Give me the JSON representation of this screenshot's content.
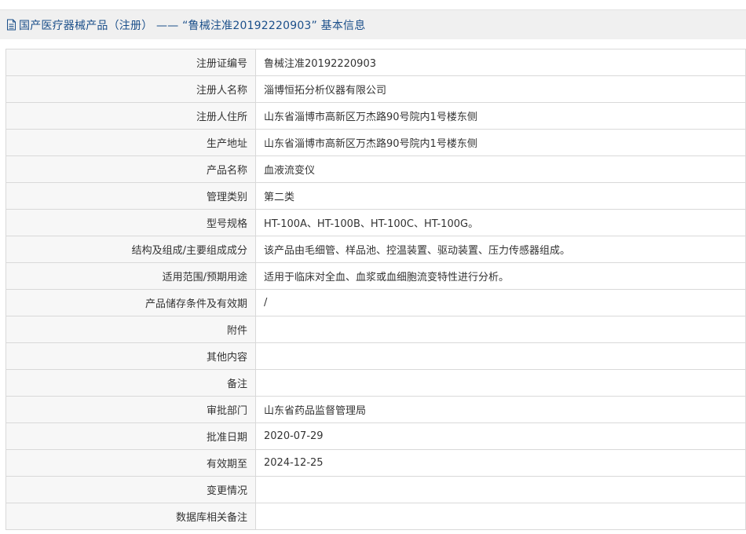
{
  "header": {
    "title": "国产医疗器械产品（注册） —— “鲁械注准20192220903” 基本信息",
    "icon": "document-icon"
  },
  "fields": [
    {
      "label": "注册证编号",
      "value": "鲁械注准20192220903"
    },
    {
      "label": "注册人名称",
      "value": "淄博恒拓分析仪器有限公司"
    },
    {
      "label": "注册人住所",
      "value": "山东省淄博市高新区万杰路90号院内1号楼东侧"
    },
    {
      "label": "生产地址",
      "value": "山东省淄博市高新区万杰路90号院内1号楼东侧"
    },
    {
      "label": "产品名称",
      "value": "血液流变仪"
    },
    {
      "label": "管理类别",
      "value": "第二类"
    },
    {
      "label": "型号规格",
      "value": "HT-100A、HT-100B、HT-100C、HT-100G。"
    },
    {
      "label": "结构及组成/主要组成成分",
      "value": "该产品由毛细管、样品池、控温装置、驱动装置、压力传感器组成。"
    },
    {
      "label": "适用范围/预期用途",
      "value": "适用于临床对全血、血浆或血细胞流变特性进行分析。"
    },
    {
      "label": "产品储存条件及有效期",
      "value": "/"
    },
    {
      "label": "附件",
      "value": ""
    },
    {
      "label": "其他内容",
      "value": ""
    },
    {
      "label": "备注",
      "value": ""
    },
    {
      "label": "审批部门",
      "value": "山东省药品监督管理局"
    },
    {
      "label": "批准日期",
      "value": "2020-07-29"
    },
    {
      "label": "有效期至",
      "value": "2024-12-25"
    },
    {
      "label": "变更情况",
      "value": ""
    },
    {
      "label": "数据库相关备注",
      "value": ""
    }
  ]
}
